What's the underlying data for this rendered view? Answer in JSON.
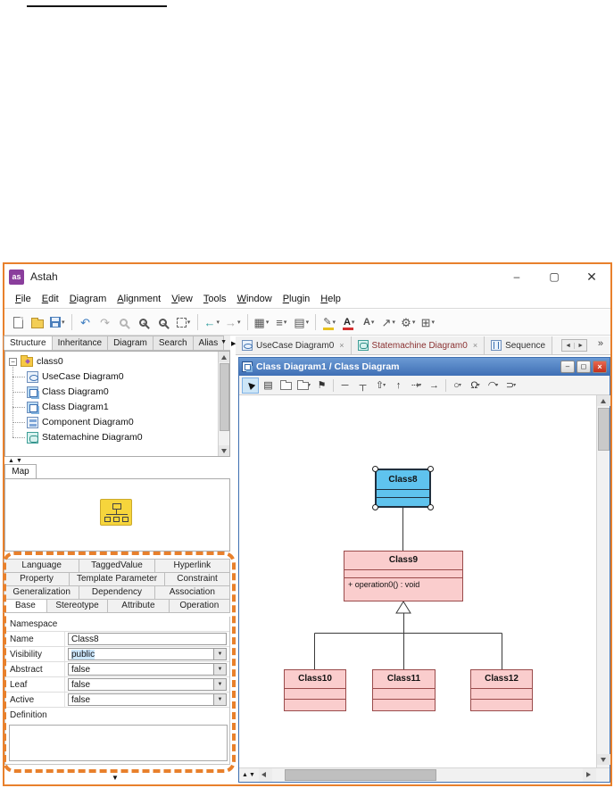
{
  "app": {
    "title": "Astah",
    "logo": "as",
    "window_controls": {
      "minimize": "–",
      "maximize": "▢",
      "close": "✕"
    }
  },
  "menu": [
    "File",
    "Edit",
    "Diagram",
    "Alignment",
    "View",
    "Tools",
    "Window",
    "Plugin",
    "Help"
  ],
  "glyphs": {
    "caret": "▾",
    "caret_down": "▼",
    "tri_up": "▲",
    "tri_down": "▼",
    "undo": "↶",
    "redo": "↷",
    "back": "←",
    "forward": "→",
    "grid": "▦",
    "align": "≡",
    "order": "▤",
    "font_a": "A",
    "pencil": "✎",
    "line": "↗",
    "gear": "⚙",
    "tree": "⊞",
    "close_x": "×",
    "nav_left": "◄",
    "nav_right": "►",
    "overflow": "»",
    "splitter": "▶",
    "minus": "−",
    "up_down": "▲▼"
  },
  "toolbar_icon_names": [
    "new-file",
    "open",
    "save",
    "undo",
    "redo",
    "zoom",
    "zoom-in",
    "zoom-out",
    "zoom-fit",
    "back",
    "forward",
    "grid",
    "align",
    "order",
    "fill-color",
    "font-color",
    "text",
    "line",
    "settings",
    "structure"
  ],
  "left_panel": {
    "tabs": [
      "Structure",
      "Inheritance",
      "Diagram",
      "Search",
      "Alias"
    ],
    "selected_tab": "Structure",
    "tree": {
      "root": "class0",
      "items": [
        "UseCase Diagram0",
        "Class Diagram0",
        "Class Diagram1",
        "Component Diagram0",
        "Statemachine Diagram0"
      ]
    },
    "map_label": "Map"
  },
  "properties": {
    "tabs_row1": [
      "Language",
      "TaggedValue",
      "Hyperlink"
    ],
    "tabs_row2": [
      "Property",
      "Template Parameter",
      "Constraint"
    ],
    "tabs_row3": [
      "Generalization",
      "Dependency",
      "Association"
    ],
    "tabs_row4": [
      "Base",
      "Stereotype",
      "Attribute",
      "Operation"
    ],
    "selected_tab": "Base",
    "namespace_label": "Namespace",
    "name_label": "Name",
    "name_value": "Class8",
    "visibility_label": "Visibility",
    "visibility_value": "public",
    "abstract_label": "Abstract",
    "abstract_value": "false",
    "leaf_label": "Leaf",
    "leaf_value": "false",
    "active_label": "Active",
    "active_value": "false",
    "definition_label": "Definition",
    "definition_value": ""
  },
  "diagram_area": {
    "tabs": [
      {
        "label": "UseCase Diagram0",
        "modified": false
      },
      {
        "label": "Statemachine Diagram0",
        "modified": true
      },
      {
        "label": "Sequence",
        "modified": false
      }
    ],
    "child_title": "Class Diagram1 / Class Diagram",
    "child_controls": {
      "minimize": "–",
      "restore": "◻",
      "close": "×"
    },
    "palette_glyphs": [
      "▤",
      "⚑",
      "─",
      "┬",
      "⇧",
      "↑",
      "⇢",
      "→",
      "○",
      "Ω",
      "◠",
      "⊃"
    ],
    "palette_names": [
      "select",
      "class",
      "package",
      "subsystem",
      "pin",
      "line",
      "anchor",
      "generalization",
      "realization",
      "dependency",
      "association",
      "interface",
      "required-interface",
      "arc",
      "usage"
    ]
  },
  "uml": {
    "classes": [
      {
        "name": "Class8",
        "selected": true
      },
      {
        "name": "Class9",
        "operation": "+ operation0() : void"
      },
      {
        "name": "Class10"
      },
      {
        "name": "Class11"
      },
      {
        "name": "Class12"
      }
    ]
  },
  "colors": {
    "highlight_orange": "#E8802C",
    "selected_class_fill": "#5FC3EE",
    "class_fill": "#FACDCD",
    "class_border": "#9A4B4B",
    "child_titlebar_blue": "#3F6FB5",
    "close_red": "#C3301B"
  }
}
